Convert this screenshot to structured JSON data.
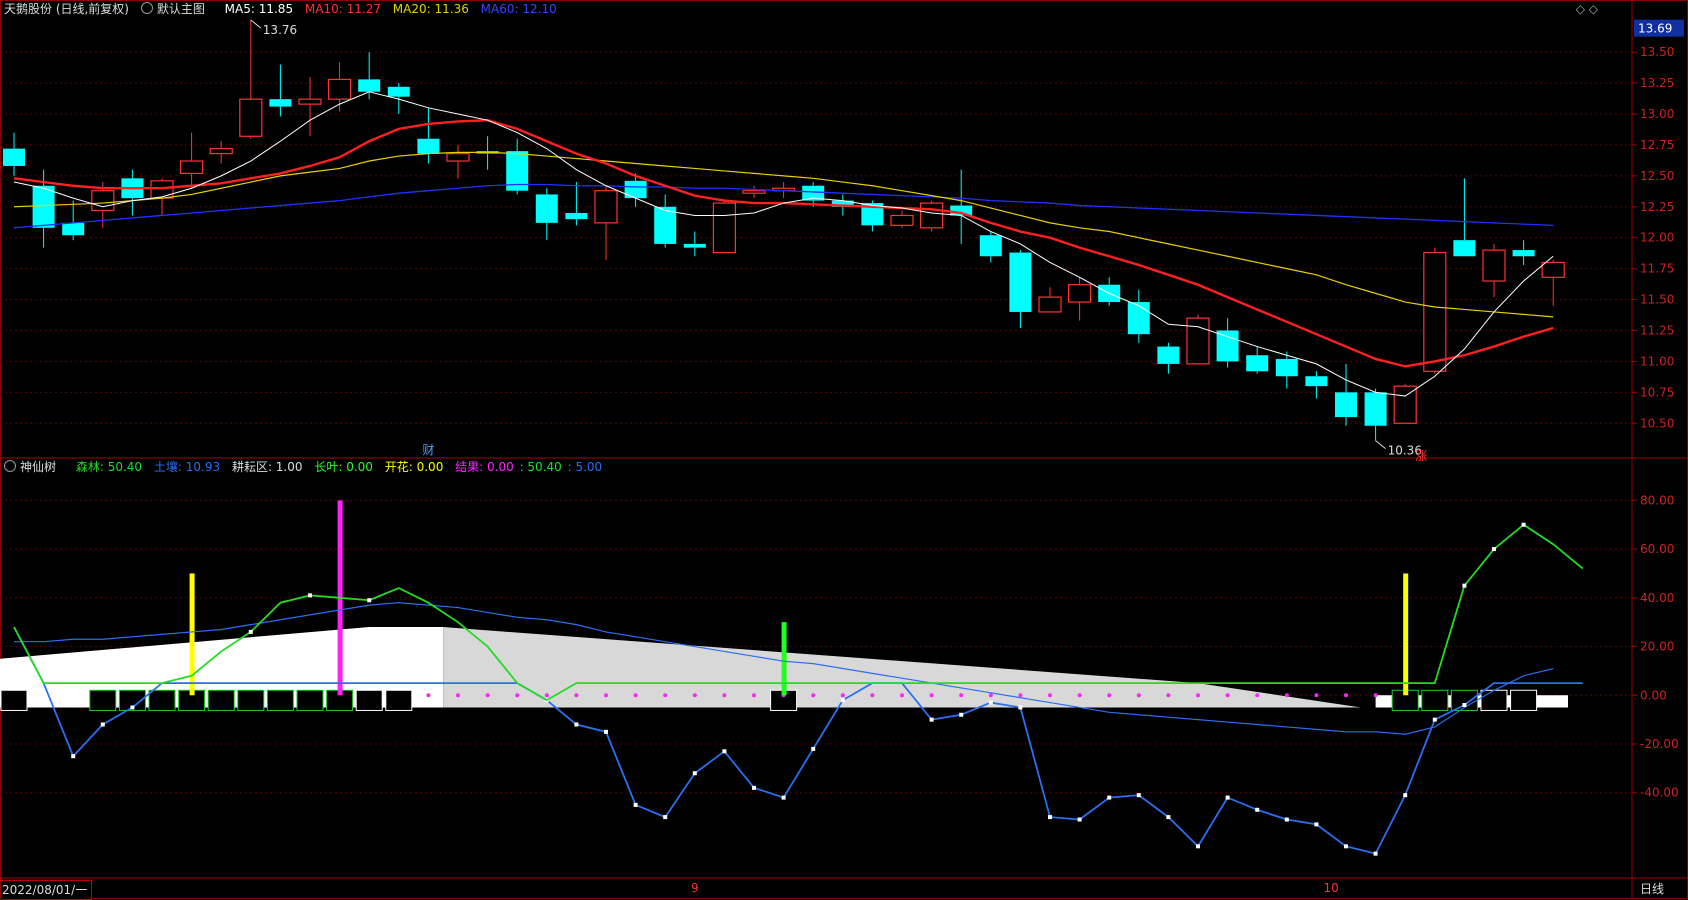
{
  "header_main": {
    "stock": "天鹅股份 (日线,前复权)",
    "indicator": "默认主图",
    "ma5": "MA5: 11.85",
    "ma10": "MA10: 11.27",
    "ma20": "MA20: 11.36",
    "ma60": "MA60: 12.10"
  },
  "header_sub": {
    "name": "神仙树",
    "senlin": "森林: 50.40",
    "turang": "土壤: 10.93",
    "gengyun": "耕耘区: 1.00",
    "zhangye": "长叶: 0.00",
    "kaihua": "开花: 0.00",
    "jieguo_label": "结果: 0.00",
    "jieguo_v2": ": 50.40",
    "jieguo_v3": ": 5.00"
  },
  "window_controls": "◇ ◇",
  "price_last_badge": "13.69",
  "bottom": {
    "date": "2022/08/01/一",
    "period": "日线",
    "month_9": "9",
    "month_10": "10"
  },
  "annotations": {
    "high": "13.76",
    "low": "10.36",
    "cai": "财",
    "zhang": "涨"
  },
  "colors": {
    "up": "#ff3333",
    "down": "#00ffff",
    "ma5": "#ffffff",
    "ma10": "#ff2020",
    "ma20": "#e8d000",
    "ma60": "#2030ff",
    "senlin": "#22dd22",
    "turang": "#2a6ff0",
    "jieguo": "#ff22ff",
    "kaihua": "#ffff00",
    "zhangye": "#22ff22"
  },
  "chart_data": [
    {
      "type": "candlestick",
      "title": "天鹅股份 (日线,前复权)",
      "ylim": [
        10.3,
        13.76
      ],
      "yticks": [
        10.5,
        10.75,
        11.0,
        11.25,
        11.5,
        11.75,
        12.0,
        12.25,
        12.5,
        12.75,
        13.0,
        13.25,
        13.5
      ],
      "candles": [
        {
          "o": 12.72,
          "c": 12.58,
          "h": 12.85,
          "l": 12.5
        },
        {
          "o": 12.42,
          "c": 12.08,
          "h": 12.55,
          "l": 11.92
        },
        {
          "o": 12.12,
          "c": 12.02,
          "h": 12.3,
          "l": 11.98
        },
        {
          "o": 12.22,
          "c": 12.38,
          "h": 12.45,
          "l": 12.08
        },
        {
          "o": 12.48,
          "c": 12.32,
          "h": 12.55,
          "l": 12.18
        },
        {
          "o": 12.32,
          "c": 12.46,
          "h": 12.48,
          "l": 12.18
        },
        {
          "o": 12.52,
          "c": 12.62,
          "h": 12.85,
          "l": 12.4
        },
        {
          "o": 12.68,
          "c": 12.72,
          "h": 12.78,
          "l": 12.6
        },
        {
          "o": 12.82,
          "c": 13.12,
          "h": 13.76,
          "l": 12.8
        },
        {
          "o": 13.12,
          "c": 13.06,
          "h": 13.4,
          "l": 12.98
        },
        {
          "o": 13.08,
          "c": 13.12,
          "h": 13.3,
          "l": 12.82
        },
        {
          "o": 13.12,
          "c": 13.28,
          "h": 13.42,
          "l": 13.02
        },
        {
          "o": 13.28,
          "c": 13.18,
          "h": 13.5,
          "l": 13.12
        },
        {
          "o": 13.22,
          "c": 13.14,
          "h": 13.25,
          "l": 13.0
        },
        {
          "o": 12.8,
          "c": 12.68,
          "h": 13.05,
          "l": 12.6
        },
        {
          "o": 12.62,
          "c": 12.68,
          "h": 12.75,
          "l": 12.48
        },
        {
          "o": 12.7,
          "c": 12.68,
          "h": 12.82,
          "l": 12.55
        },
        {
          "o": 12.7,
          "c": 12.38,
          "h": 12.8,
          "l": 12.35
        },
        {
          "o": 12.35,
          "c": 12.12,
          "h": 12.4,
          "l": 11.98
        },
        {
          "o": 12.2,
          "c": 12.15,
          "h": 12.45,
          "l": 12.1
        },
        {
          "o": 12.12,
          "c": 12.38,
          "h": 12.42,
          "l": 11.82
        },
        {
          "o": 12.46,
          "c": 12.32,
          "h": 12.52,
          "l": 12.25
        },
        {
          "o": 12.25,
          "c": 11.95,
          "h": 12.35,
          "l": 11.92
        },
        {
          "o": 11.95,
          "c": 11.92,
          "h": 12.05,
          "l": 11.85
        },
        {
          "o": 11.88,
          "c": 12.28,
          "h": 12.3,
          "l": 11.88
        },
        {
          "o": 12.36,
          "c": 12.38,
          "h": 12.42,
          "l": 12.32
        },
        {
          "o": 12.38,
          "c": 12.4,
          "h": 12.45,
          "l": 12.32
        },
        {
          "o": 12.42,
          "c": 12.3,
          "h": 12.45,
          "l": 12.25
        },
        {
          "o": 12.3,
          "c": 12.25,
          "h": 12.35,
          "l": 12.18
        },
        {
          "o": 12.28,
          "c": 12.1,
          "h": 12.3,
          "l": 12.05
        },
        {
          "o": 12.1,
          "c": 12.18,
          "h": 12.22,
          "l": 12.08
        },
        {
          "o": 12.08,
          "c": 12.28,
          "h": 12.3,
          "l": 12.05
        },
        {
          "o": 12.26,
          "c": 12.18,
          "h": 12.55,
          "l": 11.95
        },
        {
          "o": 12.02,
          "c": 11.85,
          "h": 12.05,
          "l": 11.8
        },
        {
          "o": 11.88,
          "c": 11.4,
          "h": 11.9,
          "l": 11.27
        },
        {
          "o": 11.4,
          "c": 11.52,
          "h": 11.6,
          "l": 11.4
        },
        {
          "o": 11.48,
          "c": 11.62,
          "h": 11.68,
          "l": 11.33
        },
        {
          "o": 11.62,
          "c": 11.48,
          "h": 11.68,
          "l": 11.45
        },
        {
          "o": 11.48,
          "c": 11.22,
          "h": 11.58,
          "l": 11.15
        },
        {
          "o": 11.12,
          "c": 10.98,
          "h": 11.15,
          "l": 10.9
        },
        {
          "o": 10.98,
          "c": 11.35,
          "h": 11.38,
          "l": 10.98
        },
        {
          "o": 11.25,
          "c": 11.0,
          "h": 11.35,
          "l": 10.95
        },
        {
          "o": 11.05,
          "c": 10.92,
          "h": 11.12,
          "l": 10.9
        },
        {
          "o": 11.02,
          "c": 10.88,
          "h": 11.08,
          "l": 10.78
        },
        {
          "o": 10.88,
          "c": 10.8,
          "h": 10.92,
          "l": 10.7
        },
        {
          "o": 10.75,
          "c": 10.55,
          "h": 10.98,
          "l": 10.48
        },
        {
          "o": 10.75,
          "c": 10.48,
          "h": 10.78,
          "l": 10.36
        },
        {
          "o": 10.5,
          "c": 10.8,
          "h": 10.82,
          "l": 10.5
        },
        {
          "o": 10.92,
          "c": 11.88,
          "h": 11.92,
          "l": 10.9
        },
        {
          "o": 11.98,
          "c": 11.85,
          "h": 12.48,
          "l": 11.85
        },
        {
          "o": 11.65,
          "c": 11.9,
          "h": 11.95,
          "l": 11.52
        },
        {
          "o": 11.9,
          "c": 11.85,
          "h": 11.98,
          "l": 11.78
        },
        {
          "o": 11.68,
          "c": 11.8,
          "h": 11.82,
          "l": 11.45
        }
      ],
      "ma5": [
        12.45,
        12.4,
        12.32,
        12.25,
        12.3,
        12.33,
        12.4,
        12.5,
        12.62,
        12.78,
        12.95,
        13.08,
        13.18,
        13.12,
        13.05,
        13.0,
        12.95,
        12.85,
        12.72,
        12.55,
        12.42,
        12.32,
        12.22,
        12.18,
        12.18,
        12.2,
        12.28,
        12.32,
        12.3,
        12.26,
        12.24,
        12.2,
        12.18,
        12.05,
        11.95,
        11.8,
        11.68,
        11.55,
        11.45,
        11.3,
        11.28,
        11.2,
        11.12,
        11.05,
        10.98,
        10.85,
        10.75,
        10.72,
        10.88,
        11.1,
        11.4,
        11.65,
        11.85
      ],
      "ma10": [
        12.48,
        12.45,
        12.42,
        12.4,
        12.4,
        12.4,
        12.42,
        12.44,
        12.48,
        12.52,
        12.58,
        12.65,
        12.78,
        12.88,
        12.92,
        12.94,
        12.95,
        12.88,
        12.78,
        12.68,
        12.6,
        12.5,
        12.42,
        12.34,
        12.3,
        12.28,
        12.28,
        12.27,
        12.26,
        12.25,
        12.24,
        12.23,
        12.2,
        12.12,
        12.05,
        12.0,
        11.92,
        11.85,
        11.78,
        11.7,
        11.62,
        11.52,
        11.42,
        11.32,
        11.22,
        11.12,
        11.02,
        10.96,
        11.0,
        11.05,
        11.12,
        11.2,
        11.27
      ],
      "ma20": [
        12.25,
        12.26,
        12.27,
        12.28,
        12.3,
        12.32,
        12.35,
        12.4,
        12.45,
        12.5,
        12.53,
        12.56,
        12.62,
        12.66,
        12.68,
        12.69,
        12.69,
        12.68,
        12.66,
        12.64,
        12.62,
        12.6,
        12.58,
        12.56,
        12.54,
        12.52,
        12.5,
        12.48,
        12.45,
        12.42,
        12.38,
        12.34,
        12.3,
        12.24,
        12.18,
        12.12,
        12.08,
        12.05,
        12.0,
        11.95,
        11.9,
        11.85,
        11.8,
        11.75,
        11.7,
        11.62,
        11.55,
        11.48,
        11.44,
        11.42,
        11.4,
        11.38,
        11.36
      ],
      "ma60": [
        12.08,
        12.1,
        12.12,
        12.14,
        12.16,
        12.18,
        12.2,
        12.22,
        12.24,
        12.26,
        12.28,
        12.3,
        12.33,
        12.36,
        12.38,
        12.4,
        12.42,
        12.43,
        12.43,
        12.42,
        12.42,
        12.41,
        12.41,
        12.4,
        12.4,
        12.39,
        12.38,
        12.37,
        12.36,
        12.35,
        12.34,
        12.33,
        12.32,
        12.3,
        12.29,
        12.28,
        12.26,
        12.25,
        12.24,
        12.23,
        12.22,
        12.21,
        12.2,
        12.19,
        12.18,
        12.17,
        12.16,
        12.15,
        12.14,
        12.13,
        12.12,
        12.11,
        12.1
      ]
    },
    {
      "type": "line",
      "title": "神仙树",
      "ylim": [
        -75,
        90
      ],
      "yticks": [
        80,
        60,
        40,
        20,
        0,
        -20,
        -40
      ],
      "ytick_labels": [
        "80.00",
        "60.00",
        "40.00",
        "20.00",
        "0.00",
        "-20.00",
        "-40.00"
      ],
      "series": [
        {
          "name": "森林",
          "values": [
            28,
            5,
            5,
            5,
            5,
            5,
            8,
            18,
            26,
            38,
            41,
            40,
            39,
            44,
            38,
            30,
            20,
            5,
            -2,
            5,
            5,
            5,
            5,
            5,
            5,
            5,
            5,
            5,
            5,
            5,
            5,
            5,
            5,
            5,
            5,
            5,
            5,
            5,
            5,
            5,
            5,
            5,
            5,
            5,
            5,
            5,
            5,
            5,
            5,
            45,
            60,
            70,
            62,
            52
          ]
        },
        {
          "name": "土壤",
          "values": [
            22,
            22,
            23,
            23,
            24,
            25,
            26,
            27,
            29,
            31,
            33,
            35,
            37,
            38,
            37,
            36,
            34,
            32,
            31,
            29,
            26,
            24,
            22,
            20,
            18,
            16,
            14,
            13,
            11,
            9,
            7,
            5,
            3,
            1,
            -1,
            -3,
            -5,
            -7,
            -8,
            -9,
            -10,
            -11,
            -12,
            -13,
            -14,
            -15,
            -15,
            -16,
            -13,
            -5,
            2,
            8,
            10.93
          ]
        },
        {
          "name": "结果线",
          "values": [
            28,
            5,
            -25,
            -12,
            -5,
            5,
            5,
            5,
            5,
            5,
            5,
            5,
            5,
            5,
            5,
            5,
            5,
            5,
            -2,
            -12,
            -15,
            -45,
            -50,
            -32,
            -23,
            -38,
            -42,
            -22,
            -2,
            5,
            5,
            -10,
            -8,
            -3,
            -5,
            -50,
            -51,
            -42,
            -41,
            -50,
            -62,
            -42,
            -47,
            -51,
            -53,
            -62,
            -65,
            -41,
            -10,
            -4,
            5,
            5,
            5,
            5
          ]
        }
      ],
      "bars": [
        {
          "name": "开花",
          "index": 6,
          "value": 50
        },
        {
          "name": "结果",
          "index": 11,
          "value": 80
        },
        {
          "name": "长叶",
          "index": 26,
          "value": 30
        },
        {
          "name": "开花",
          "index": 47,
          "value": 50
        }
      ]
    }
  ]
}
